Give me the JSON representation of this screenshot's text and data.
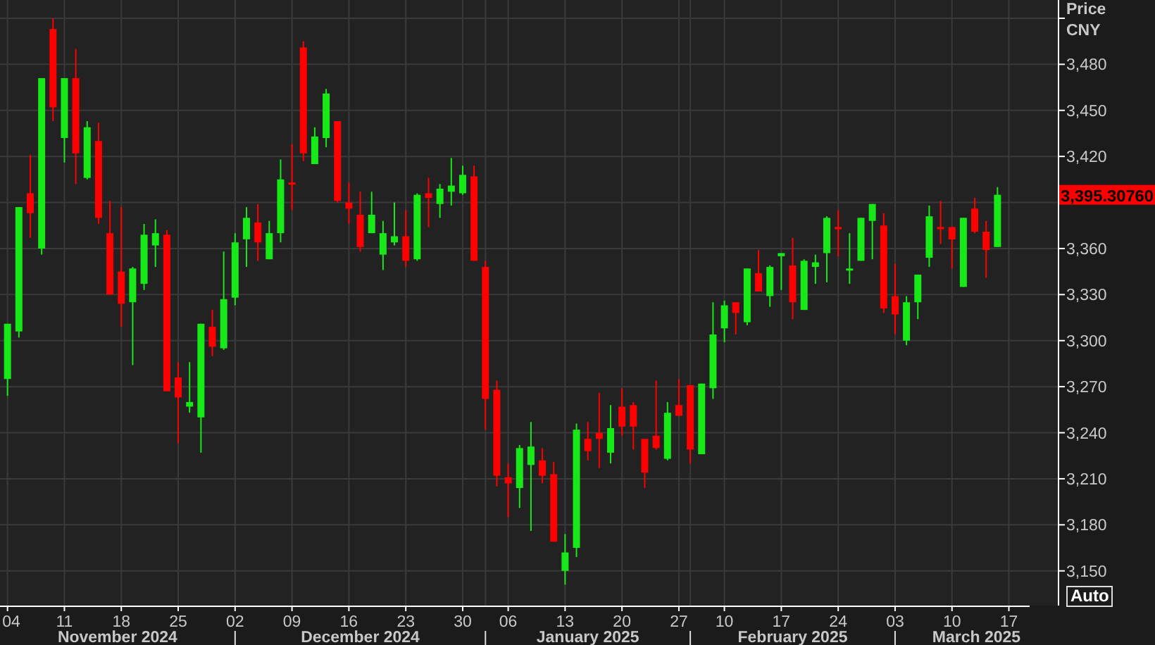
{
  "chart": {
    "chart_data": {
      "type": "candlestick",
      "ylabel": "Price",
      "ylim": [
        3127.4,
        3521.9
      ],
      "grid": true,
      "categories": [
        "04",
        null,
        null,
        null,
        null,
        "11",
        null,
        null,
        null,
        null,
        "18",
        null,
        null,
        null,
        null,
        "25",
        null,
        null,
        null,
        null,
        "02",
        null,
        null,
        null,
        null,
        "09",
        null,
        null,
        null,
        null,
        "16",
        null,
        null,
        null,
        null,
        "23",
        null,
        null,
        null,
        null,
        "30",
        null,
        null,
        null,
        "06",
        null,
        null,
        null,
        null,
        "13",
        null,
        null,
        null,
        null,
        "20",
        null,
        null,
        null,
        null,
        "27",
        null,
        null,
        null,
        "10",
        null,
        null,
        null,
        null,
        "17",
        null,
        null,
        null,
        null,
        "24",
        null,
        null,
        null,
        null,
        "03",
        null,
        null,
        null,
        null,
        "10",
        null,
        null,
        null,
        null,
        "17"
      ],
      "yticks": [
        {
          "value": 3150,
          "label": "3,150"
        },
        {
          "value": 3180,
          "label": "3,180"
        },
        {
          "value": 3210,
          "label": "3,210"
        },
        {
          "value": 3240,
          "label": "3,240"
        },
        {
          "value": 3270,
          "label": "3,270"
        },
        {
          "value": 3300,
          "label": "3,300"
        },
        {
          "value": 3330,
          "label": "3,330"
        },
        {
          "value": 3360,
          "label": "3,360"
        },
        {
          "value": 3420,
          "label": "3,420"
        },
        {
          "value": 3450,
          "label": "3,450"
        },
        {
          "value": 3480,
          "label": "3,480"
        }
      ],
      "ohlc": [
        [
          3275,
          3311,
          3264,
          3311
        ],
        [
          3306,
          3387,
          3302,
          3387
        ],
        [
          3396,
          3421,
          3367,
          3383
        ],
        [
          3360,
          3471,
          3356,
          3471
        ],
        [
          3503,
          3510,
          3443,
          3452
        ],
        [
          3432,
          3471,
          3416,
          3471
        ],
        [
          3471,
          3490,
          3402,
          3422
        ],
        [
          3406,
          3443,
          3405,
          3439
        ],
        [
          3430,
          3442,
          3376,
          3380
        ],
        [
          3370,
          3391,
          3330,
          3330
        ],
        [
          3345,
          3387,
          3309,
          3324
        ],
        [
          3325,
          3348,
          3284,
          3347
        ],
        [
          3337,
          3376,
          3333,
          3369
        ],
        [
          3362,
          3379,
          3348,
          3370
        ],
        [
          3369,
          3372,
          3267,
          3267
        ],
        [
          3276,
          3286,
          3233,
          3263
        ],
        [
          3257,
          3286,
          3253,
          3260
        ],
        [
          3250,
          3311,
          3227,
          3311
        ],
        [
          3309,
          3320,
          3290,
          3296
        ],
        [
          3295,
          3358,
          3294,
          3327
        ],
        [
          3328,
          3370,
          3323,
          3364
        ],
        [
          3366,
          3387,
          3348,
          3380
        ],
        [
          3377,
          3389,
          3352,
          3364
        ],
        [
          3353,
          3378,
          3353,
          3370
        ],
        [
          3370,
          3418,
          3364,
          3405
        ],
        [
          3403,
          3428,
          3385,
          3402
        ],
        [
          3491,
          3495,
          3417,
          3422
        ],
        [
          3415,
          3439,
          3415,
          3433
        ],
        [
          3432,
          3464,
          3426,
          3461
        ],
        [
          3443,
          3443,
          3390,
          3391
        ],
        [
          3390,
          3403,
          3376,
          3386
        ],
        [
          3382,
          3397,
          3358,
          3361
        ],
        [
          3370,
          3397,
          3370,
          3382
        ],
        [
          3356,
          3378,
          3346,
          3370
        ],
        [
          3364,
          3390,
          3362,
          3368
        ],
        [
          3368,
          3385,
          3348,
          3352
        ],
        [
          3353,
          3396,
          3352,
          3395
        ],
        [
          3396,
          3406,
          3374,
          3393
        ],
        [
          3389,
          3402,
          3380,
          3399
        ],
        [
          3397,
          3419,
          3388,
          3401
        ],
        [
          3396,
          3414,
          3395,
          3408
        ],
        [
          3407,
          3414,
          3352,
          3352
        ],
        [
          3348,
          3352,
          3242,
          3262
        ],
        [
          3268,
          3274,
          3205,
          3212
        ],
        [
          3211,
          3220,
          3185,
          3207
        ],
        [
          3204,
          3232,
          3191,
          3230
        ],
        [
          3219,
          3247,
          3176,
          3231
        ],
        [
          3222,
          3230,
          3207,
          3212
        ],
        [
          3213,
          3221,
          3169,
          3169
        ],
        [
          3150,
          3174,
          3141,
          3162
        ],
        [
          3165,
          3246,
          3159,
          3242
        ],
        [
          3236,
          3247,
          3222,
          3228
        ],
        [
          3240,
          3266,
          3217,
          3236
        ],
        [
          3227,
          3258,
          3220,
          3243
        ],
        [
          3257,
          3269,
          3238,
          3244
        ],
        [
          3258,
          3260,
          3229,
          3244
        ],
        [
          3236,
          3236,
          3204,
          3214
        ],
        [
          3238,
          3274,
          3229,
          3230
        ],
        [
          3223,
          3260,
          3222,
          3253
        ],
        [
          3258,
          3275,
          3251,
          3251
        ],
        [
          3271,
          3271,
          3220,
          3229
        ],
        [
          3226,
          3272,
          3226,
          3272
        ],
        [
          3269,
          3325,
          3262,
          3304
        ],
        [
          3308,
          3326,
          3299,
          3323
        ],
        [
          3325,
          3325,
          3304,
          3318
        ],
        [
          3312,
          3347,
          3310,
          3347
        ],
        [
          3344,
          3359,
          3332,
          3332
        ],
        [
          3329,
          3349,
          3322,
          3348
        ],
        [
          3355,
          3357,
          3333,
          3357
        ],
        [
          3349,
          3367,
          3314,
          3325
        ],
        [
          3320,
          3353,
          3320,
          3352
        ],
        [
          3348,
          3356,
          3337,
          3351
        ],
        [
          3357,
          3381,
          3338,
          3380
        ],
        [
          3374,
          3385,
          3355,
          3373
        ],
        [
          3346,
          3370,
          3337,
          3347
        ],
        [
          3352,
          3380,
          3352,
          3380
        ],
        [
          3378,
          3389,
          3353,
          3389
        ],
        [
          3375,
          3383,
          3318,
          3321
        ],
        [
          3329,
          3350,
          3304,
          3317
        ],
        [
          3300,
          3329,
          3297,
          3325
        ],
        [
          3325,
          3343,
          3314,
          3343
        ],
        [
          3354,
          3388,
          3348,
          3381
        ],
        [
          3374,
          3391,
          3363,
          3373
        ],
        [
          3374,
          3374,
          3347,
          3366
        ],
        [
          3335,
          3380,
          3335,
          3380
        ],
        [
          3386,
          3393,
          3370,
          3371
        ],
        [
          3371,
          3378,
          3341,
          3359
        ],
        [
          3361,
          3400,
          3361,
          3395
        ],
        null
      ],
      "annotations": [
        "3,395.30760"
      ]
    },
    "y_axis": {
      "unit": "CNY"
    },
    "x_axis": {
      "months": [
        "November 2024",
        "December 2024",
        "January 2025",
        "February 2025",
        "March 2025"
      ]
    },
    "scale_button": {
      "label": "Auto"
    }
  }
}
